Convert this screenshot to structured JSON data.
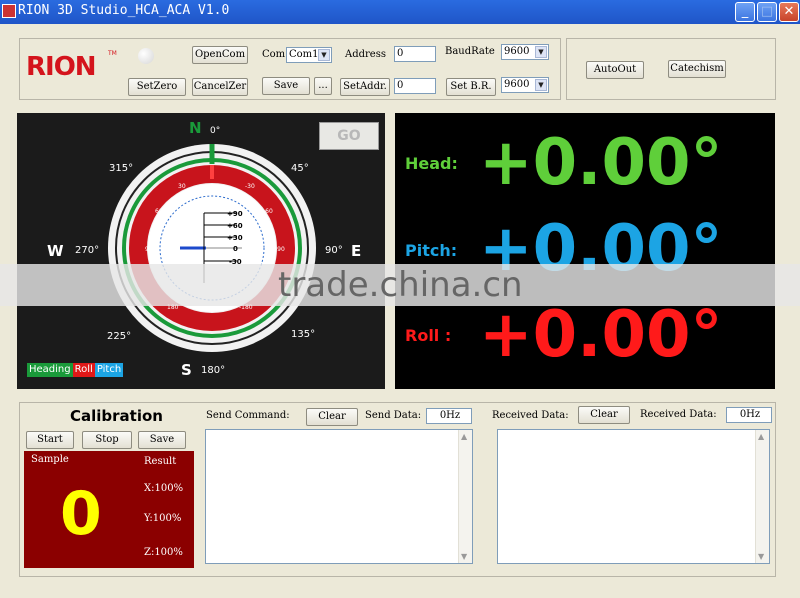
{
  "window": {
    "title": "RION 3D Studio_HCA_ACA V1.0"
  },
  "toolbar": {
    "logo_text": "RION",
    "logo_tm": "TM",
    "open_com": "OpenCom",
    "set_zero": "SetZero",
    "cancel_zero": "CancelZer",
    "com_label": "Com",
    "com_value": "Com1",
    "save": "Save",
    "ellipsis": "...",
    "address_label": "Address",
    "address_value": "0",
    "set_addr": "SetAddr.",
    "set_addr_value": "0",
    "baudrate_label": "BaudRate",
    "baudrate_value": "9600",
    "set_br": "Set B.R.",
    "set_br_value": "9600",
    "auto_out": "AutoOut",
    "catechism": "Catechism"
  },
  "compass": {
    "go": "GO",
    "north": "N",
    "south": "S",
    "east": "E",
    "west": "W",
    "deg_0": "0°",
    "deg_45": "45°",
    "deg_90": "90°",
    "deg_135": "135°",
    "deg_180": "180°",
    "deg_225": "225°",
    "deg_270": "270°",
    "deg_315": "315°",
    "roll_ticks": [
      "0",
      "30",
      "-30",
      "60",
      "-60",
      "90",
      "-90",
      "180",
      "-180"
    ],
    "pitch_ticks": [
      "+90",
      "+60",
      "+30",
      "0",
      "-30"
    ],
    "legend_heading": "Heading",
    "legend_roll": "Roll",
    "legend_pitch": "Pitch"
  },
  "readout": {
    "head_label": "Head:",
    "head_value": "+0.00°",
    "pitch_label": "Pitch:",
    "pitch_value": "+0.00°",
    "roll_label": "Roll :",
    "roll_value": "+0.00°"
  },
  "watermark": "trade.china.cn",
  "calibration": {
    "title": "Calibration",
    "start": "Start",
    "stop": "Stop",
    "save": "Save",
    "sample_label": "Sample",
    "result_label": "Result",
    "sample_value": "0",
    "x": "X:100%",
    "y": "Y:100%",
    "z": "Z:100%"
  },
  "send": {
    "label": "Send Command:",
    "clear": "Clear",
    "data_label": "Send Data:",
    "data_value": "0Hz"
  },
  "receive": {
    "label": "Received Data:",
    "clear": "Clear",
    "data_label": "Received Data:",
    "data_value": "0Hz"
  },
  "colors": {
    "heading": "#1a9a3a",
    "roll": "#e01818",
    "pitch": "#1ca4e4",
    "head_text": "#5fcf3a",
    "pitch_text": "#1ca4e4",
    "roll_text": "#ff1a1a",
    "sample_bg": "#8b0000",
    "sample_value": "#ffff00"
  },
  "icons": [
    "app-icon",
    "minimize-icon",
    "maximize-icon",
    "close-icon",
    "status-led-icon",
    "chevron-down-icon",
    "scroll-up-icon",
    "scroll-down-icon"
  ]
}
